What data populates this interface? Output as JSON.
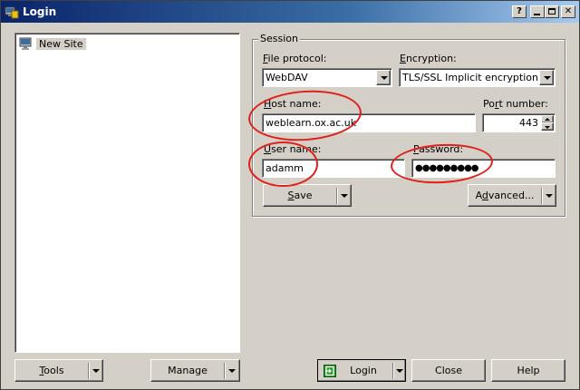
{
  "window": {
    "title": "Login"
  },
  "sites": [
    {
      "label": "New Site"
    }
  ],
  "session": {
    "group_title": "Session",
    "file_protocol": {
      "label_accel": "F",
      "label_rest": "ile protocol:",
      "value": "WebDAV"
    },
    "encryption": {
      "label_accel": "E",
      "label_rest": "ncryption:",
      "value": "TLS/SSL Implicit encryption"
    },
    "host_name": {
      "label_accel": "H",
      "label_rest": "ost name:",
      "value": "weblearn.ox.ac.uk"
    },
    "port_number": {
      "label_pre": "Po",
      "label_accel": "r",
      "label_rest": "t number:",
      "value": "443"
    },
    "user_name": {
      "label_accel": "U",
      "label_rest": "ser name:",
      "value": "adamm"
    },
    "password": {
      "label_accel": "P",
      "label_rest": "assword:",
      "value": "●●●●●●●●●"
    }
  },
  "buttons": {
    "save": {
      "accel": "S",
      "rest": "ave"
    },
    "advanced": {
      "pre": "A",
      "accel": "d",
      "rest": "vanced..."
    },
    "tools": {
      "accel": "T",
      "rest": "ools"
    },
    "manage": {
      "label": "Manage"
    },
    "login": {
      "label": "Login"
    },
    "close": {
      "label": "Close"
    },
    "help": {
      "label": "Help"
    }
  },
  "colors": {
    "annotation": "#e0201a",
    "title_bar": "#0a246a"
  }
}
